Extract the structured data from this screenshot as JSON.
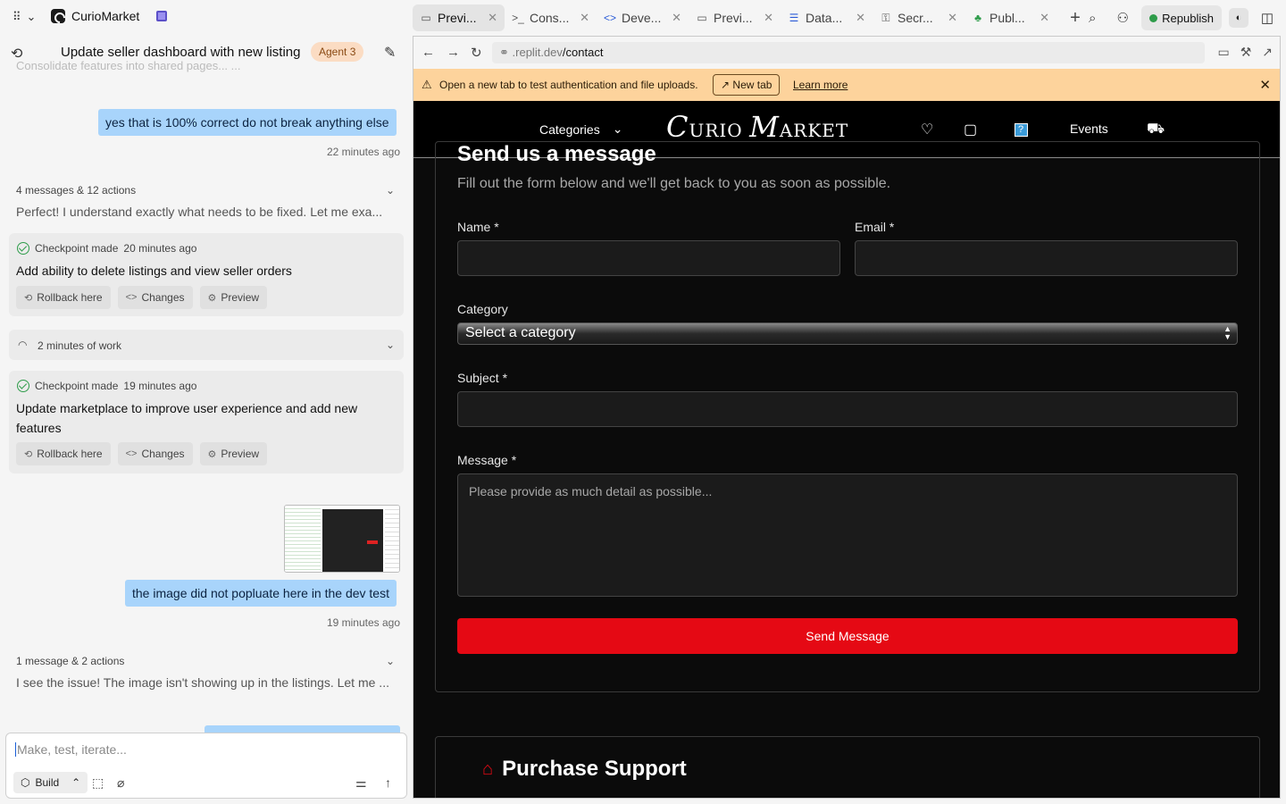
{
  "app": {
    "name": "CurioMarket"
  },
  "tabs": [
    {
      "icon": "preview-icon",
      "glyph": "▭",
      "label": "Previ...",
      "active": true
    },
    {
      "icon": "console-icon",
      "glyph": ">_",
      "label": "Cons...",
      "active": false
    },
    {
      "icon": "code-icon",
      "glyph": "<>",
      "label": "Deve...",
      "active": false
    },
    {
      "icon": "preview-icon",
      "glyph": "▭",
      "label": "Previ...",
      "active": false
    },
    {
      "icon": "database-icon",
      "glyph": "☰",
      "label": "Data...",
      "active": false
    },
    {
      "icon": "lock-icon",
      "glyph": "🔒",
      "label": "Secr...",
      "active": false
    },
    {
      "icon": "publish-icon",
      "glyph": "♣",
      "label": "Publ...",
      "active": false
    }
  ],
  "top_actions": {
    "republish": "Republish"
  },
  "chat": {
    "title": "Update seller dashboard with new listing ...",
    "agent_badge": "Agent 3",
    "faded_line": "Consolidate features into shared pages... ...",
    "msg1": {
      "text": "yes that is 100% correct do not break anything else",
      "time": "22 minutes ago"
    },
    "summary1": {
      "label": "4 messages & 12 actions",
      "text": "Perfect! I understand exactly what needs to be fixed. Let me exa..."
    },
    "checkpoint1": {
      "head": "Checkpoint made",
      "time": "20 minutes ago",
      "title": "Add ability to delete listings and view seller orders"
    },
    "work": {
      "label": "2 minutes of work"
    },
    "checkpoint2": {
      "head": "Checkpoint made",
      "time": "19 minutes ago",
      "title": "Update marketplace to improve user experience and add new features"
    },
    "checkpoint_buttons": {
      "rollback": "Rollback here",
      "changes": "Changes",
      "preview": "Preview"
    },
    "msg2": {
      "text": "the image did not popluate here in the dev test",
      "time": "19 minutes ago"
    },
    "summary2": {
      "label": "1 message & 2 actions",
      "text": "I see the issue! The image isn't showing up in the listings. Let me ..."
    },
    "composer": {
      "placeholder": "Make, test, iterate...",
      "mode": "Build"
    }
  },
  "browser": {
    "url_domain": ".replit.dev",
    "url_path": "/contact",
    "notice": {
      "text": "Open a new tab to test authentication and file uploads.",
      "new_tab": "New tab",
      "learn_more": "Learn more"
    }
  },
  "site": {
    "nav": {
      "categories": "Categories",
      "logo_c": "C",
      "logo_urio": "URIO ",
      "logo_m": "M",
      "logo_arket": "ARKET",
      "help": "?",
      "events": "Events"
    },
    "form": {
      "title": "Send us a message",
      "subtitle": "Fill out the form below and we'll get back to you as soon as possible.",
      "name_label": "Name *",
      "email_label": "Email *",
      "category_label": "Category",
      "category_value": "Select a category",
      "subject_label": "Subject *",
      "message_label": "Message *",
      "message_placeholder": "Please provide as much detail as possible...",
      "submit": "Send Message"
    },
    "support": {
      "title": "Purchase Support"
    }
  },
  "colors": {
    "accent_red": "#e50914",
    "notice_bg": "#fdd39c",
    "bubble": "#a8d4fb",
    "agent_badge": "#fbdcc3"
  }
}
